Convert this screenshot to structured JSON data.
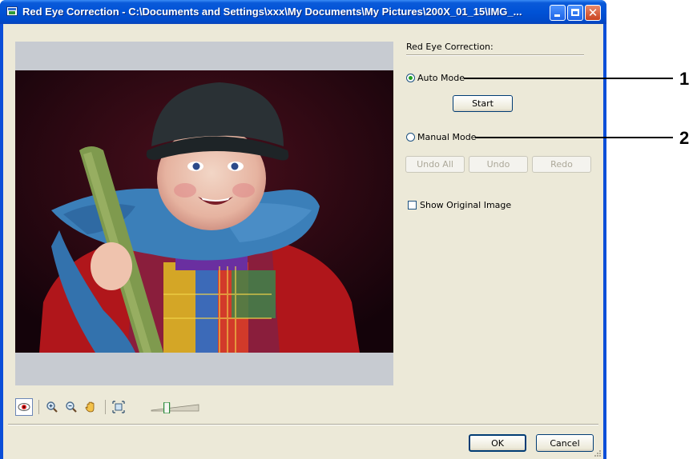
{
  "window": {
    "title": "Red Eye Correction - C:\\Documents and Settings\\xxx\\My Documents\\My Pictures\\200X_01_15\\IMG_...",
    "minimize_icon": "minimize-icon",
    "maximize_icon": "maximize-icon",
    "close_icon": "close-icon"
  },
  "panel": {
    "title": "Red Eye Correction:",
    "auto_mode_label": "Auto Mode",
    "auto_mode_checked": true,
    "start_label": "Start",
    "manual_mode_label": "Manual Mode",
    "manual_mode_checked": false,
    "undo_all_label": "Undo All",
    "undo_label": "Undo",
    "redo_label": "Redo",
    "show_original_label": "Show Original Image",
    "show_original_checked": false
  },
  "toolbar": {
    "tools": [
      "red-eye-icon",
      "zoom-in-icon",
      "zoom-out-icon",
      "hand-pan-icon",
      "fit-to-window-icon"
    ],
    "zoom_slider_level": 0.3
  },
  "buttons": {
    "ok_label": "OK",
    "cancel_label": "Cancel"
  },
  "callouts": [
    {
      "number": "1"
    },
    {
      "number": "2"
    }
  ],
  "colors": {
    "titlebar": "#0052d6",
    "dialog_bg": "#ece9d8",
    "radio_dot": "#21a121"
  }
}
